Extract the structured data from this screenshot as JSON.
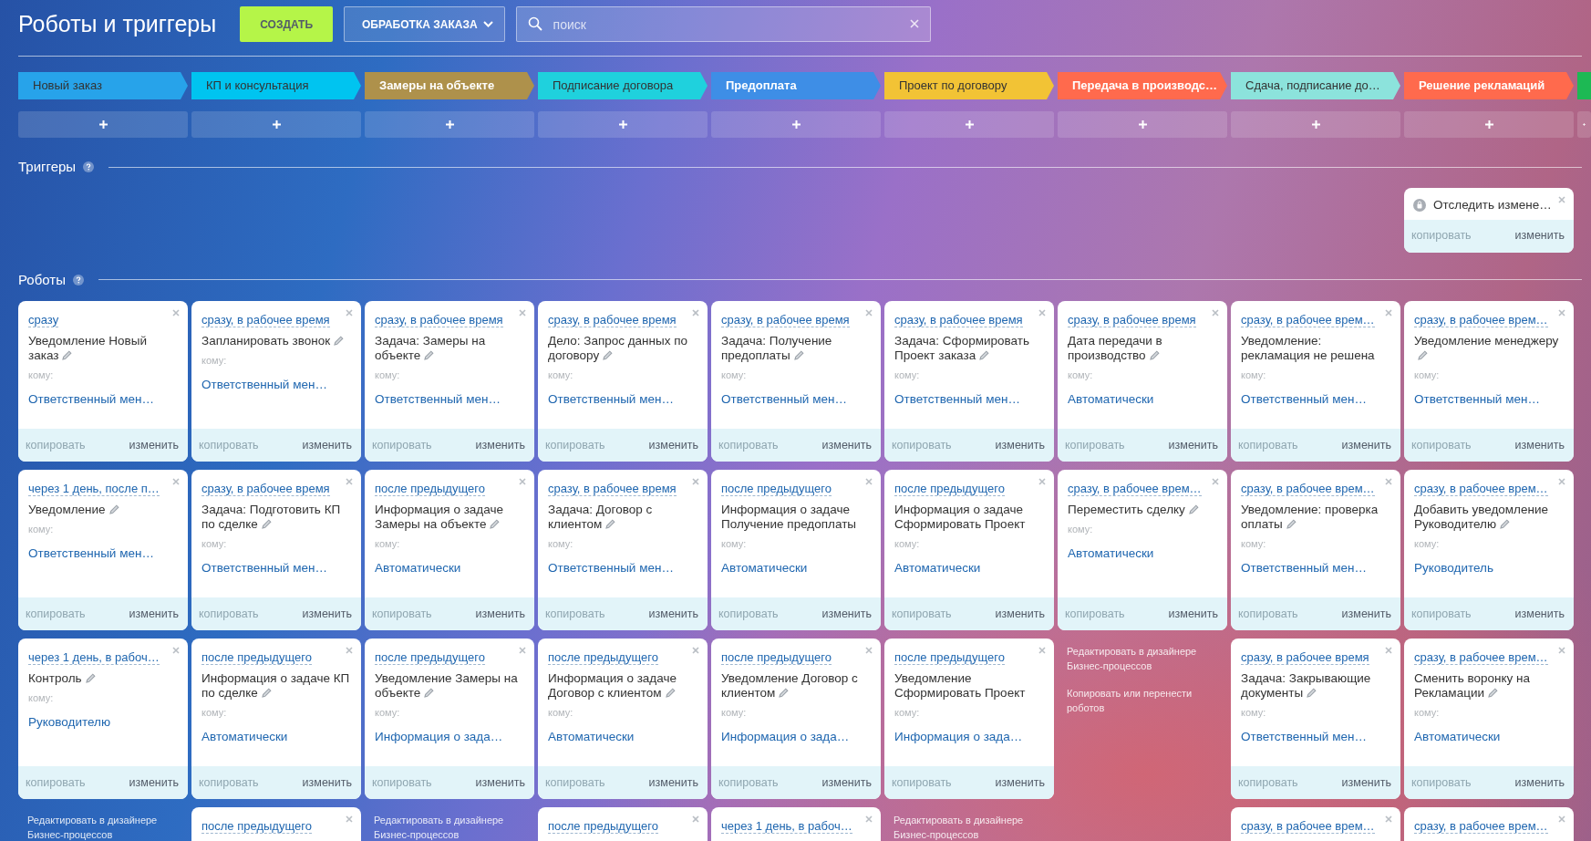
{
  "header": {
    "title": "Роботы и триггеры",
    "create_button": "СОЗДАТЬ",
    "funnel_dropdown": "ОБРАБОТКА ЗАКАЗА",
    "search": {
      "placeholder": "поиск"
    }
  },
  "triggers_heading": "Триггеры",
  "robots_heading": "Роботы",
  "stages": [
    {
      "label": "Новый заказ",
      "color": "#27a3ea",
      "light_text": false,
      "robots": [
        {
          "kind": "robot",
          "delay": "сразу",
          "title": "Уведомление Новый заказ",
          "pencil": true,
          "to_label": "кому:",
          "to": "Ответственный мен…",
          "copy": "копировать",
          "edit": "изменить"
        },
        {
          "kind": "robot",
          "delay": "через 1 день, после п…",
          "title": "Уведомление",
          "pencil": true,
          "to_label": "кому:",
          "to": "Ответственный мен…",
          "copy": "копировать",
          "edit": "изменить"
        },
        {
          "kind": "robot",
          "delay": "через 1 день, в рабоч…",
          "title": "Контроль",
          "pencil": true,
          "to_label": "кому:",
          "to": "Руководителю",
          "copy": "копировать",
          "edit": "изменить"
        },
        {
          "kind": "links",
          "links": [
            "Редактировать в дизайнере Бизнес-процессов"
          ]
        }
      ]
    },
    {
      "label": "КП и консультация",
      "color": "#00c4f0",
      "light_text": false,
      "robots": [
        {
          "kind": "robot",
          "delay": "сразу, в рабочее время",
          "title": "Запланировать звонок",
          "pencil": true,
          "to_label": "кому:",
          "to": "Ответственный мен…",
          "copy": "копировать",
          "edit": "изменить"
        },
        {
          "kind": "robot",
          "delay": "сразу, в рабочее время",
          "title": "Задача: Подготовить КП по сделке",
          "pencil": true,
          "to_label": "кому:",
          "to": "Ответственный мен…",
          "copy": "копировать",
          "edit": "изменить"
        },
        {
          "kind": "robot",
          "delay": "после предыдущего",
          "title": "Информация о задаче КП по сделке",
          "pencil": true,
          "to_label": "кому:",
          "to": "Автоматически",
          "copy": "копировать",
          "edit": "изменить"
        },
        {
          "kind": "robot",
          "delay": "после предыдущего"
        }
      ]
    },
    {
      "label": "Замеры на объекте",
      "color": "#ae914b",
      "light_text": true,
      "robots": [
        {
          "kind": "robot",
          "delay": "сразу, в рабочее время",
          "title": "Задача: Замеры на объекте",
          "pencil": true,
          "to_label": "кому:",
          "to": "Ответственный мен…",
          "copy": "копировать",
          "edit": "изменить"
        },
        {
          "kind": "robot",
          "delay": "после предыдущего",
          "title": "Информация о задаче Замеры на объекте",
          "pencil": true,
          "to_label": "кому:",
          "to": "Автоматически",
          "copy": "копировать",
          "edit": "изменить"
        },
        {
          "kind": "robot",
          "delay": "после предыдущего",
          "title": "Уведомление Замеры на объекте",
          "pencil": true,
          "to_label": "кому:",
          "to": "Информация о зада…",
          "copy": "копировать",
          "edit": "изменить"
        },
        {
          "kind": "links",
          "links": [
            "Редактировать в дизайнере Бизнес-процессов"
          ]
        }
      ]
    },
    {
      "label": "Подписание договора",
      "color": "#1fd1dd",
      "light_text": false,
      "robots": [
        {
          "kind": "robot",
          "delay": "сразу, в рабочее время",
          "title": "Дело: Запрос данных по договору",
          "pencil": true,
          "to_label": "кому:",
          "to": "Ответственный мен…",
          "copy": "копировать",
          "edit": "изменить"
        },
        {
          "kind": "robot",
          "delay": "сразу, в рабочее время",
          "title": "Задача: Договор с клиентом",
          "pencil": true,
          "to_label": "кому:",
          "to": "Ответственный мен…",
          "copy": "копировать",
          "edit": "изменить"
        },
        {
          "kind": "robot",
          "delay": "после предыдущего",
          "title": "Информация о задаче Договор с клиентом",
          "pencil": true,
          "to_label": "кому:",
          "to": "Автоматически",
          "copy": "копировать",
          "edit": "изменить"
        },
        {
          "kind": "robot",
          "delay": "после предыдущего"
        }
      ]
    },
    {
      "label": "Предоплата",
      "color": "#3e8ee6",
      "light_text": true,
      "robots": [
        {
          "kind": "robot",
          "delay": "сразу, в рабочее время",
          "title": "Задача: Получение предоплаты",
          "pencil": true,
          "to_label": "кому:",
          "to": "Ответственный мен…",
          "copy": "копировать",
          "edit": "изменить"
        },
        {
          "kind": "robot",
          "delay": "после предыдущего",
          "title": "Информация о задаче Получение предоплаты",
          "pencil": false,
          "to_label": "кому:",
          "to": "Автоматически",
          "copy": "копировать",
          "edit": "изменить"
        },
        {
          "kind": "robot",
          "delay": "после предыдущего",
          "title": "Уведомление Договор с клиентом",
          "pencil": true,
          "to_label": "кому:",
          "to": "Информация о зада…",
          "copy": "копировать",
          "edit": "изменить"
        },
        {
          "kind": "robot",
          "delay": "через 1 день, в рабоч…"
        }
      ]
    },
    {
      "label": "Проект по договору",
      "color": "#f2c335",
      "light_text": false,
      "robots": [
        {
          "kind": "robot",
          "delay": "сразу, в рабочее время",
          "title": "Задача: Сформировать Проект заказа",
          "pencil": true,
          "to_label": "кому:",
          "to": "Ответственный мен…",
          "copy": "копировать",
          "edit": "изменить"
        },
        {
          "kind": "robot",
          "delay": "после предыдущего",
          "title": "Информация о задаче Сформировать Проект",
          "pencil": false,
          "to_label": "кому:",
          "to": "Автоматически",
          "copy": "копировать",
          "edit": "изменить"
        },
        {
          "kind": "robot",
          "delay": "после предыдущего",
          "title": "Уведомление Сформировать Проект",
          "pencil": false,
          "to_label": "кому:",
          "to": "Информация о зада…",
          "copy": "копировать",
          "edit": "изменить"
        },
        {
          "kind": "links",
          "links": [
            "Редактировать в дизайнере Бизнес-процессов"
          ]
        }
      ]
    },
    {
      "label": "Передача в производс…",
      "color": "#ff6a4d",
      "light_text": true,
      "robots": [
        {
          "kind": "robot",
          "delay": "сразу, в рабочее время",
          "title": "Дата передачи в производство",
          "pencil": true,
          "to_label": "кому:",
          "to": "Автоматически",
          "copy": "копировать",
          "edit": "изменить"
        },
        {
          "kind": "robot",
          "delay": "сразу, в рабочее врем…",
          "title": "Переместить сделку",
          "pencil": true,
          "to_label": "кому:",
          "to": "Автоматически",
          "copy": "копировать",
          "edit": "изменить"
        },
        {
          "kind": "links",
          "links": [
            "Редактировать в дизайнере Бизнес-процессов",
            "Копировать или перенести роботов"
          ]
        }
      ]
    },
    {
      "label": "Сдача, подписание до…",
      "color": "#8ce3dc",
      "light_text": false,
      "robots": [
        {
          "kind": "robot",
          "delay": "сразу, в рабочее врем…",
          "title": "Уведомление: рекламация не решена",
          "pencil": false,
          "to_label": "кому:",
          "to": "Ответственный мен…",
          "copy": "копировать",
          "edit": "изменить"
        },
        {
          "kind": "robot",
          "delay": "сразу, в рабочее врем…",
          "title": "Уведомление: проверка оплаты",
          "pencil": true,
          "to_label": "кому:",
          "to": "Ответственный мен…",
          "copy": "копировать",
          "edit": "изменить"
        },
        {
          "kind": "robot",
          "delay": "сразу, в рабочее время",
          "title": "Задача: Закрывающие документы",
          "pencil": true,
          "to_label": "кому:",
          "to": "Ответственный мен…",
          "copy": "копировать",
          "edit": "изменить"
        },
        {
          "kind": "robot",
          "delay": "сразу, в рабочее врем…"
        }
      ]
    },
    {
      "label": "Решение рекламаций",
      "color": "#ff6a4d",
      "light_text": true,
      "triggers": [
        {
          "title": "Отследить измене…",
          "copy": "копировать",
          "edit": "изменить"
        }
      ],
      "robots": [
        {
          "kind": "robot",
          "delay": "сразу, в рабочее врем…",
          "title": "Уведомление менеджеру",
          "pencil": true,
          "to_label": "кому:",
          "to": "Ответственный мен…",
          "copy": "копировать",
          "edit": "изменить"
        },
        {
          "kind": "robot",
          "delay": "сразу, в рабочее врем…",
          "title": "Добавить уведомление Руководителю",
          "pencil": true,
          "to_label": "кому:",
          "to": "Руководитель",
          "copy": "копировать",
          "edit": "изменить"
        },
        {
          "kind": "robot",
          "delay": "сразу, в рабочее врем…",
          "title": "Сменить воронку на Рекламации",
          "pencil": true,
          "to_label": "кому:",
          "to": "Автоматически",
          "copy": "копировать",
          "edit": "изменить"
        },
        {
          "kind": "robot",
          "delay": "сразу, в рабочее врем…"
        }
      ]
    },
    {
      "color": "#1db954"
    }
  ]
}
